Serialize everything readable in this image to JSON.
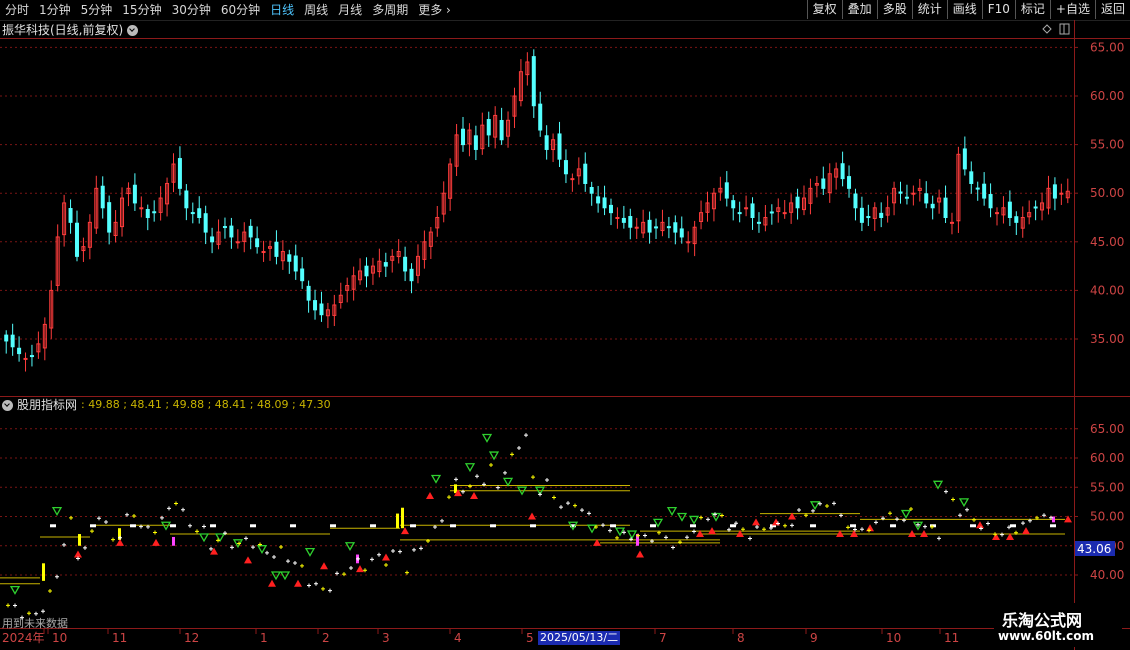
{
  "toolbar": {
    "periods": [
      "分时",
      "1分钟",
      "5分钟",
      "15分钟",
      "30分钟",
      "60分钟",
      "日线",
      "周线",
      "月线",
      "多周期",
      "更多"
    ],
    "active": "日线",
    "right_buttons": [
      "复权",
      "叠加",
      "多股",
      "统计",
      "画线",
      "F10",
      "标记",
      "+自选",
      "返回"
    ]
  },
  "main_chart": {
    "title": "振华科技(日线,前复权)",
    "y_ticks": [
      "65.00",
      "60.00",
      "55.00",
      "50.00",
      "45.00",
      "40.00",
      "35.00"
    ]
  },
  "indicator": {
    "title": "股朋指标网",
    "values_text": ": 49.88 ; 48.41 ; 49.88 ; 48.41 ; 48.09 ; 47.30",
    "y_ticks": [
      "65.00",
      "60.00",
      "55.00",
      "50.00",
      "45.00",
      "40.00"
    ],
    "price_tag": "43.06",
    "foot_note": "用到未来数据"
  },
  "x_axis": {
    "labels": [
      "2024年",
      "10",
      "11",
      "12",
      "1",
      "2",
      "3",
      "4",
      "5",
      "7",
      "8",
      "9",
      "10",
      "11"
    ],
    "highlight": "2025/05/13/二"
  },
  "watermark": {
    "line1": "乐淘公式网",
    "line2": "www.60lt.com"
  },
  "colors": {
    "up": "#ff3c3c",
    "down": "#54ffff",
    "grid": "#7a1414",
    "yellow": "#ffff00"
  },
  "chart_data": {
    "type": "candlestick",
    "ylim": [
      31,
      67
    ],
    "close": [
      34.8,
      34.2,
      33.5,
      33.0,
      33.2,
      34.5,
      36.5,
      40.0,
      45.5,
      49.0,
      47.0,
      43.5,
      44.5,
      47.0,
      50.5,
      48.5,
      46.0,
      47.0,
      49.5,
      50.5,
      49.0,
      48.5,
      47.5,
      48.0,
      49.5,
      51.0,
      53.0,
      50.5,
      48.5,
      48.0,
      47.5,
      46.0,
      45.0,
      46.0,
      46.5,
      45.5,
      45.0,
      46.0,
      45.5,
      44.5,
      44.0,
      44.5,
      43.5,
      44.0,
      43.0,
      42.0,
      41.0,
      39.0,
      38.0,
      37.5,
      38.0,
      38.5,
      39.5,
      40.5,
      41.5,
      42.0,
      41.5,
      42.5,
      43.0,
      42.5,
      43.5,
      44.0,
      42.0,
      41.0,
      43.5,
      45.0,
      46.0,
      47.5,
      50.0,
      53.0,
      56.0,
      55.0,
      56.5,
      54.5,
      57.0,
      56.0,
      58.0,
      55.5,
      57.5,
      60.0,
      62.5,
      63.5,
      59.0,
      56.5,
      54.5,
      55.5,
      53.5,
      52.0,
      51.5,
      52.5,
      51.0,
      50.0,
      49.0,
      48.5,
      48.0,
      47.5,
      47.0,
      46.5,
      46.5,
      47.0,
      46.0,
      46.5,
      47.0,
      46.5,
      46.0,
      45.5,
      45.0,
      46.5,
      48.0,
      49.0,
      50.0,
      50.5,
      49.5,
      48.5,
      48.0,
      48.5,
      47.5,
      47.0,
      47.5,
      48.0,
      48.5,
      48.0,
      49.0,
      48.5,
      49.5,
      50.5,
      51.0,
      50.5,
      52.0,
      52.5,
      51.5,
      50.5,
      48.5,
      47.0,
      47.5,
      48.5,
      47.5,
      48.5,
      50.5,
      50.0,
      49.5,
      50.0,
      50.5,
      49.0,
      48.5,
      49.5,
      47.5,
      47.0,
      54.0,
      52.5,
      51.0,
      50.5,
      49.5,
      48.5,
      48.0,
      48.5,
      47.5,
      47.0,
      47.5,
      48.0,
      48.5,
      49.0,
      50.5,
      49.5,
      50.0,
      50.2
    ]
  }
}
